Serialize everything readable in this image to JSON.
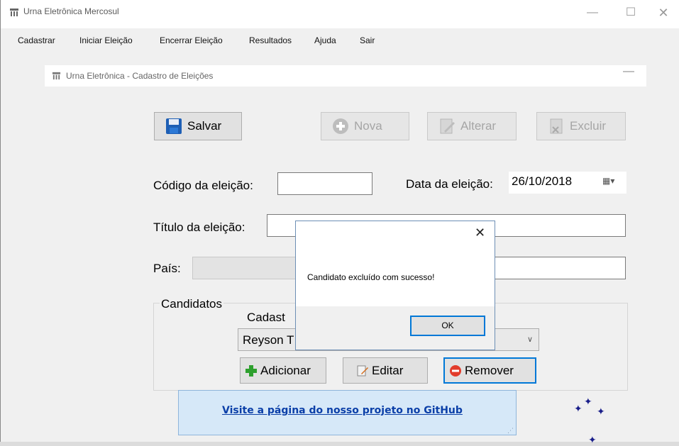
{
  "window": {
    "title": "Urna Eletrônica Mercosul",
    "controls": {
      "minimize": "—",
      "maximize": "☐",
      "close": "✕"
    }
  },
  "menu": [
    "Cadastrar",
    "Iniciar Eleição",
    "Encerrar Eleição",
    "Resultados",
    "Ajuda",
    "Sair"
  ],
  "child": {
    "title": "Urna Eletrônica - Cadastro de Eleições",
    "minimize": "—"
  },
  "toolbar": {
    "salvar": "Salvar",
    "nova": "Nova",
    "alterar": "Alterar",
    "excluir": "Excluir"
  },
  "form": {
    "codigo_label": "Código da eleição:",
    "codigo_value": "",
    "data_label": "Data da eleição:",
    "data_value": "26/10/2018",
    "titulo_label": "Título da eleição:",
    "titulo_value": "",
    "pais_label": "País:",
    "pais_value": ""
  },
  "candidatos": {
    "group_label": "Candidatos",
    "cadastrados_label": "Cadast",
    "selected": "Reyson T",
    "adicionar": "Adicionar",
    "editar": "Editar",
    "remover": "Remover"
  },
  "github": {
    "link_text": "Visite a página do nosso projeto no GitHub"
  },
  "dialog": {
    "close": "✕",
    "message": "Candidato excluído com sucesso!",
    "ok": "OK"
  },
  "colors": {
    "accent": "#0078d7",
    "link": "#0b3fa8",
    "panel": "#d6e8f8"
  }
}
